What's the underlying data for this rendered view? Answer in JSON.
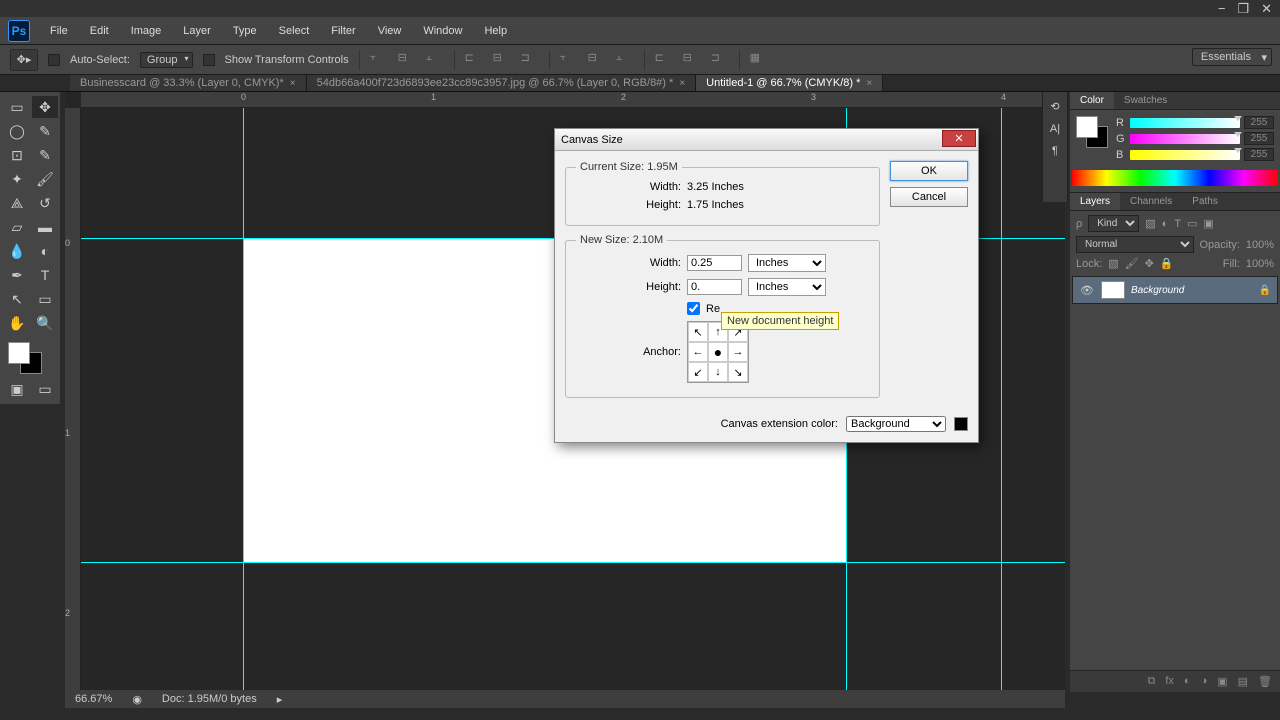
{
  "titlebar": {
    "minimize": "−",
    "maximize": "❐",
    "close": "✕"
  },
  "menu": [
    "File",
    "Edit",
    "Image",
    "Layer",
    "Type",
    "Select",
    "Filter",
    "View",
    "Window",
    "Help"
  ],
  "options": {
    "autoSelect": "Auto-Select:",
    "group": "Group",
    "transform": "Show Transform Controls"
  },
  "essentials": "Essentials",
  "tabs": [
    {
      "label": "Businesscard @ 33.3% (Layer 0, CMYK)*",
      "active": false
    },
    {
      "label": "54db66a400f723d6893ee23cc89c3957.jpg @ 66.7% (Layer 0, RGB/8#) *",
      "active": false
    },
    {
      "label": "Untitled-1 @ 66.7% (CMYK/8) *",
      "active": true
    }
  ],
  "ruler": {
    "h": [
      "0",
      "1",
      "2",
      "3",
      "4"
    ],
    "v": [
      "0",
      "1",
      "2"
    ]
  },
  "colorPanel": {
    "tabs": [
      "Color",
      "Swatches"
    ],
    "channels": [
      {
        "l": "R",
        "v": "255"
      },
      {
        "l": "G",
        "v": "255"
      },
      {
        "l": "B",
        "v": "255"
      }
    ]
  },
  "layersPanel": {
    "tabs": [
      "Layers",
      "Channels",
      "Paths"
    ],
    "kind": "Kind",
    "blend": "Normal",
    "opacityLabel": "Opacity:",
    "opacity": "100%",
    "lockLabel": "Lock:",
    "fillLabel": "Fill:",
    "fill": "100%",
    "layer": {
      "name": "Background"
    }
  },
  "dialog": {
    "title": "Canvas Size",
    "ok": "OK",
    "cancel": "Cancel",
    "currentSize": "Current Size: 1.95M",
    "curWidthLabel": "Width:",
    "curWidth": "3.25 Inches",
    "curHeightLabel": "Height:",
    "curHeight": "1.75 Inches",
    "newSize": "New Size: 2.10M",
    "widthLabel": "Width:",
    "widthVal": "0.25",
    "widthUnit": "Inches",
    "heightLabel": "Height:",
    "heightVal": "0.",
    "heightUnit": "Inches",
    "relative": "Re",
    "anchorLabel": "Anchor:",
    "extColorLabel": "Canvas extension color:",
    "extColor": "Background",
    "tooltip": "New document height"
  },
  "status": {
    "zoom": "66.67%",
    "doc": "Doc: 1.95M/0 bytes"
  }
}
